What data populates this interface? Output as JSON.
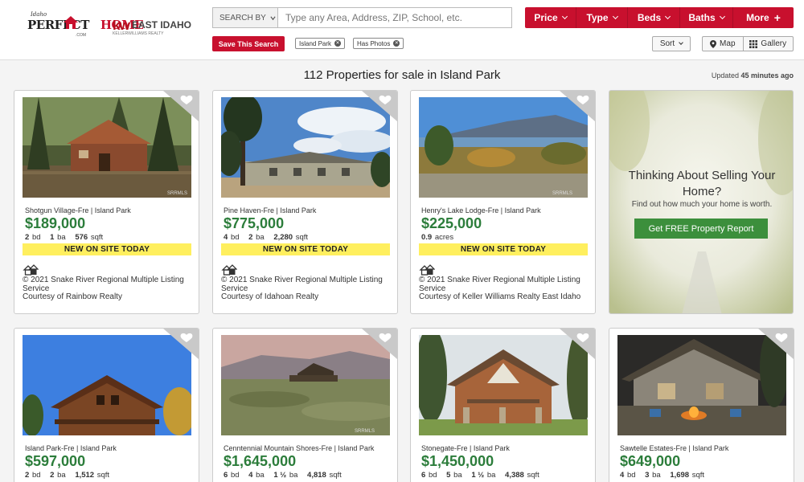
{
  "header": {
    "logo_small": "Idaho",
    "logo_main_a": "PERFECT",
    "logo_main_b": "HOME",
    "logo_sub": ".COM",
    "kw_logo": "kw",
    "kw_name": "EAST IDAHO",
    "kw_sub": "KELLERWILLIAMS REALTY",
    "search_by": "SEARCH BY",
    "search_placeholder": "Type any Area, Address, ZIP, School, etc.",
    "filters": [
      {
        "label": "Price"
      },
      {
        "label": "Type"
      },
      {
        "label": "Beds"
      },
      {
        "label": "Baths"
      },
      {
        "label": "More"
      }
    ],
    "save_search": "Save This Search",
    "tags": [
      "Island Park",
      "Has Photos"
    ],
    "sort": "Sort",
    "map": "Map",
    "gallery": "Gallery"
  },
  "results": {
    "title": "112 Properties for sale in Island Park",
    "updated_prefix": "Updated",
    "updated_value": "45 minutes ago"
  },
  "listings": [
    {
      "area": "Shotgun Village-Fre | Island Park",
      "price": "$189,000",
      "bd": "2",
      "ba": "1",
      "sqft": "576",
      "badge": "NEW ON SITE TODAY",
      "courtesy_1": "© 2021 Snake River Regional Multiple Listing Service",
      "courtesy_2": "Courtesy of Rainbow Realty"
    },
    {
      "area": "Pine Haven-Fre | Island Park",
      "price": "$775,000",
      "bd": "4",
      "ba": "2",
      "sqft": "2,280",
      "badge": "NEW ON SITE TODAY",
      "courtesy_1": "© 2021 Snake River Regional Multiple Listing Service",
      "courtesy_2": "Courtesy of Idahoan Realty"
    },
    {
      "area": "Henry's Lake Lodge-Fre | Island Park",
      "price": "$225,000",
      "acres": "0.9",
      "badge": "NEW ON SITE TODAY",
      "courtesy_1": "© 2021 Snake River Regional Multiple Listing Service",
      "courtesy_2": "Courtesy of Keller Williams Realty East Idaho"
    },
    {
      "area": "Island Park-Fre | Island Park",
      "price": "$597,000",
      "bd": "2",
      "ba": "2",
      "sqft": "1,512"
    },
    {
      "area": "Cenntennial Mountain Shores-Fre | Island Park",
      "price": "$1,645,000",
      "bd": "6",
      "ba": "4",
      "half": "1 ½",
      "sqft": "4,818"
    },
    {
      "area": "Stonegate-Fre | Island Park",
      "price": "$1,450,000",
      "bd": "6",
      "ba": "5",
      "half": "1 ½",
      "sqft": "4,388"
    },
    {
      "area": "Sawtelle Estates-Fre | Island Park",
      "price": "$649,000",
      "bd": "4",
      "ba": "3",
      "sqft": "1,698"
    }
  ],
  "units": {
    "bd": "bd",
    "ba": "ba",
    "sqft": "sqft",
    "acres": "acres"
  },
  "promo": {
    "title": "Thinking About Selling Your Home?",
    "subtitle": "Find out how much your home is worth.",
    "button": "Get FREE Property Report"
  },
  "watermark": "SRRMLS",
  "colors": {
    "brand_red": "#c8102e",
    "price_green": "#2c7d3b",
    "badge_yellow": "#ffef5e",
    "promo_button": "#3c8f3c"
  }
}
